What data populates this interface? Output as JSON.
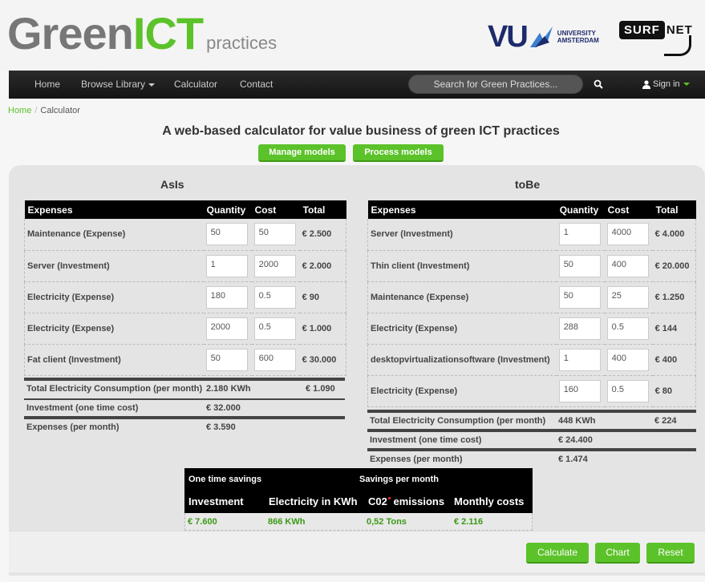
{
  "logo": {
    "green": "Green",
    "ict": "ICT",
    "practices": "practices"
  },
  "partners": {
    "vu": "VU",
    "vu_sub1": "UNIVERSITY",
    "vu_sub2": "AMSTERDAM",
    "surf": "SURF",
    "net": "NET"
  },
  "nav": {
    "home": "Home",
    "browse": "Browse Library",
    "calculator": "Calculator",
    "contact": "Contact",
    "search_placeholder": "Search for Green Practices...",
    "signin": "Sign in"
  },
  "breadcrumb": {
    "home": "Home",
    "sep": "/",
    "current": "Calculator"
  },
  "page_title": "A web-based calculator for value business of green ICT practices",
  "buttons": {
    "manage": "Manage models",
    "process": "Process models",
    "calculate": "Calculate",
    "chart": "Chart",
    "reset": "Reset"
  },
  "asis": {
    "title": "AsIs",
    "headers": [
      "Expenses",
      "Quantity",
      "Cost",
      "Total"
    ],
    "rows": [
      {
        "name": "Maintenance (Expense)",
        "qty": "50",
        "cost": "50",
        "total": "€ 2.500"
      },
      {
        "name": "Server (Investment)",
        "qty": "1",
        "cost": "2000",
        "total": "€ 2.000"
      },
      {
        "name": "Electricity (Expense)",
        "qty": "180",
        "cost": "0.5",
        "total": "€ 90"
      },
      {
        "name": "Electricity (Expense)",
        "qty": "2000",
        "cost": "0.5",
        "total": "€ 1.000"
      },
      {
        "name": "Fat client (Investment)",
        "qty": "50",
        "cost": "600",
        "total": "€ 30.000"
      }
    ],
    "summary": {
      "elec_label": "Total Electricity Consumption (per month)",
      "elec_kwh": "2.180 KWh",
      "elec_total": "€ 1.090",
      "inv_label": "Investment (one time cost)",
      "inv_value": "€ 32.000",
      "exp_label": "Expenses (per month)",
      "exp_value": "€ 3.590"
    }
  },
  "tobe": {
    "title": "toBe",
    "headers": [
      "Expenses",
      "Quantity",
      "Cost",
      "Total"
    ],
    "rows": [
      {
        "name": "Server (Investment)",
        "qty": "1",
        "cost": "4000",
        "total": "€ 4.000"
      },
      {
        "name": "Thin client (Investment)",
        "qty": "50",
        "cost": "400",
        "total": "€ 20.000"
      },
      {
        "name": "Maintenance (Expense)",
        "qty": "50",
        "cost": "25",
        "total": "€ 1.250"
      },
      {
        "name": "Electricity (Expense)",
        "qty": "288",
        "cost": "0.5",
        "total": "€ 144"
      },
      {
        "name": "desktopvirtualizationsoftware (Investment)",
        "qty": "1",
        "cost": "400",
        "total": "€ 400"
      },
      {
        "name": "Electricity (Expense)",
        "qty": "160",
        "cost": "0.5",
        "total": "€ 80"
      }
    ],
    "summary": {
      "elec_label": "Total Electricity Consumption (per month)",
      "elec_kwh": "448 KWh",
      "elec_total": "€ 224",
      "inv_label": "Investment (one time cost)",
      "inv_value": "€ 24.400",
      "exp_label": "Expenses (per month)",
      "exp_value": "€ 1.474"
    }
  },
  "savings": {
    "one_time": "One time savings",
    "per_month": "Savings per month",
    "col_investment": "Investment",
    "col_electricity": "Electricity in KWh",
    "col_co2": "C02",
    "col_co2_suffix": "emissions",
    "col_monthly": "Monthly costs",
    "investment": "€ 7.600",
    "electricity": "866 KWh",
    "co2": "0,52 Tons",
    "monthly": "€ 2.116"
  },
  "colors": {
    "brand_green": "#5cc22a",
    "navbar": "#1a1a1a",
    "vu_blue": "#1d2a6b"
  },
  "icons": {
    "search": "search-icon",
    "user": "user-icon",
    "vu_logo": "vu-bird-icon"
  }
}
